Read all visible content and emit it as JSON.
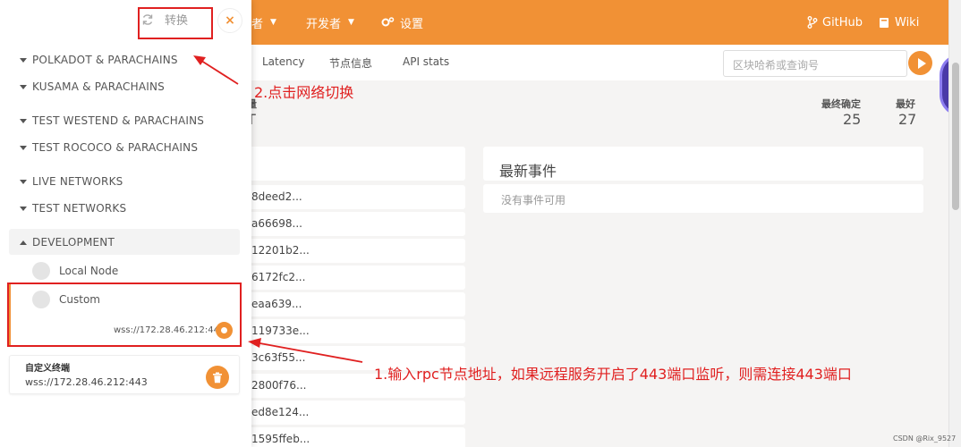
{
  "topnav": {
    "partial_item": "者",
    "developer": "开发者",
    "settings": "设置",
    "github": "GitHub",
    "wiki": "Wiki"
  },
  "subnav": {
    "tabs": [
      "Latency",
      "节点信息",
      "API stats"
    ],
    "search_placeholder": "区块哈希或查询号"
  },
  "stats": {
    "partial_label": "量",
    "partial_value": "T",
    "finalized_label": "最终确定",
    "finalized_value": "25",
    "best_label": "最好",
    "best_value": "27"
  },
  "events": {
    "title": "最新事件",
    "empty": "没有事件可用"
  },
  "hashes": [
    "8deed2...",
    "a66698...",
    "12201b2...",
    "6172fc2...",
    "eaa639...",
    "119733e...",
    "3c63f55...",
    "2800f76...",
    "ed8e124...",
    "1595ffeb..."
  ],
  "panel": {
    "switch_label": "转换",
    "close": "×",
    "groups": [
      "POLKADOT & PARACHAINS",
      "KUSAMA & PARACHAINS",
      "TEST WESTEND & PARACHAINS",
      "TEST ROCOCO & PARACHAINS",
      "LIVE NETWORKS",
      "TEST NETWORKS",
      "DEVELOPMENT"
    ],
    "local_node": "Local Node",
    "custom": "Custom",
    "custom_url": "wss://172.28.46.212:443",
    "endpoint_title": "自定义终端",
    "endpoint_url": "wss://172.28.46.212:443"
  },
  "annotations": {
    "step1": "1.输入rpc节点地址，如果远程服务开启了443端口监听，则需连接443端口",
    "step2": "2.点击网络切换"
  },
  "watermark": "CSDN @Rix_9527",
  "colors": {
    "accent": "#f19135",
    "annotation": "#e02020"
  },
  "icons": [
    "refresh-icon",
    "close-icon",
    "gear-icon",
    "git-icon",
    "book-icon",
    "trash-icon",
    "play-icon"
  ]
}
